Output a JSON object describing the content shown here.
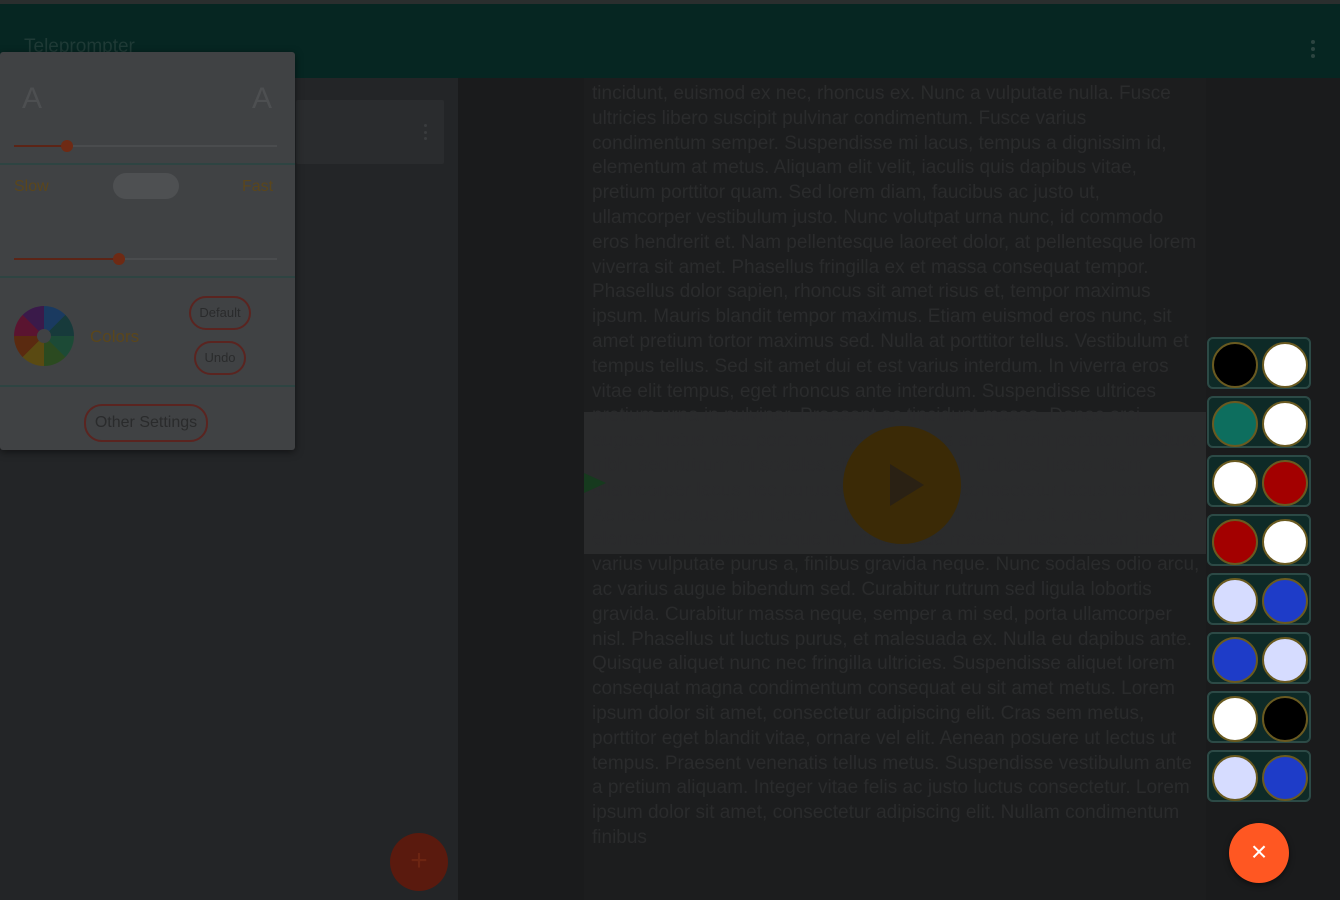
{
  "app": {
    "title": "Teleprompter"
  },
  "settings": {
    "font_small_glyph": "A",
    "font_large_glyph": "A",
    "font_size_level": 0.2,
    "speed_slow_label": "Slow",
    "speed_fast_label": "Fast",
    "speed_level": 0.4,
    "colors_label": "Colors",
    "default_label": "Default",
    "undo_label": "Undo",
    "other_settings_label": "Other Settings"
  },
  "script": {
    "text": "tincidunt, euismod ex nec, rhoncus ex. Nunc a vulputate nulla. Fusce ultricies libero suscipit pulvinar condimentum. Fusce varius condimentum semper. Suspendisse mi lacus, tempus a dignissim id, elementum at metus. Aliquam elit velit, iaculis quis dapibus vitae, pretium porttitor quam. Sed lorem diam, faucibus ac justo ut, ullamcorper vestibulum justo. Nunc volutpat urna nunc, id commodo eros hendrerit et. Nam pellentesque laoreet dolor, at pellentesque lorem viverra sit amet. Phasellus fringilla ex et massa consequat tempor. Phasellus dolor sapien, rhoncus sit amet risus et, tempor maximus ipsum. Mauris blandit tempor maximus. Etiam euismod eros nunc, sit amet pretium tortor maximus sed. Nulla at porttitor tellus. Vestibulum et tempus tellus. Sed sit amet dui et est varius interdum. In viverra eros vitae elit tempus, eget rhoncus ante interdum. Suspendisse ultrices pretium urna in pulvinar. Praesent ac tincidunt massa. Donec orci augue, luctus vitae porta vel, iaculis cursus ante. Proin porttitor tincidunt nibh, sed rutrum mi sodales sit amet. Nulla in ultricies libero. Nam ullamcorper lacus nec purus sollicitudin, eu consectetur lacus lacinia. Aenean cursus diam lorem, a posuere diam volutpat sit amet. In at ante elementum, pulvinar neque in, malesuada massa. Fusce sapien justo, varius vulputate purus a, finibus gravida neque. Nunc sodales odio arcu, ac varius augue bibendum sed. Curabitur rutrum sed ligula lobortis gravida. Curabitur massa neque, semper a mi sed, porta ullamcorper nisl. Phasellus ut luctus purus, et malesuada ex. Nulla eu dapibus ante. Quisque aliquet nunc nec fringilla ultricies. Suspendisse aliquet lorem consequat magna condimentum consequat eu sit amet metus. Lorem ipsum dolor sit amet, consectetur adipiscing elit. Cras sem metus, porttitor eget blandit vitae, ornare vel elit. Aenean posuere ut lectus ut tempus. Praesent venenatis tellus metus. Suspendisse vestibulum ante a pretium aliquam. Integer vitae felis ac justo luctus consectetur. Lorem ipsum dolor sit amet, consectetur adipiscing elit. Nullam condimentum finibus"
  },
  "color_schemes": [
    {
      "background": "#000000",
      "text": "#ffffff"
    },
    {
      "background": "#0d6e5e",
      "text": "#ffffff"
    },
    {
      "background": "#ffffff",
      "text": "#a30000"
    },
    {
      "background": "#a30000",
      "text": "#ffffff"
    },
    {
      "background": "#d6dcff",
      "text": "#1e3cc8"
    },
    {
      "background": "#1e3cc8",
      "text": "#d6dcff"
    },
    {
      "background": "#ffffff",
      "text": "#000000"
    },
    {
      "background": "#d6dcff",
      "text": "#1e3cc8"
    }
  ],
  "icons": {
    "add_glyph": "+",
    "close_glyph": "×"
  },
  "colors": {
    "accent": "#ff5722",
    "primary_dark": "#062622"
  }
}
